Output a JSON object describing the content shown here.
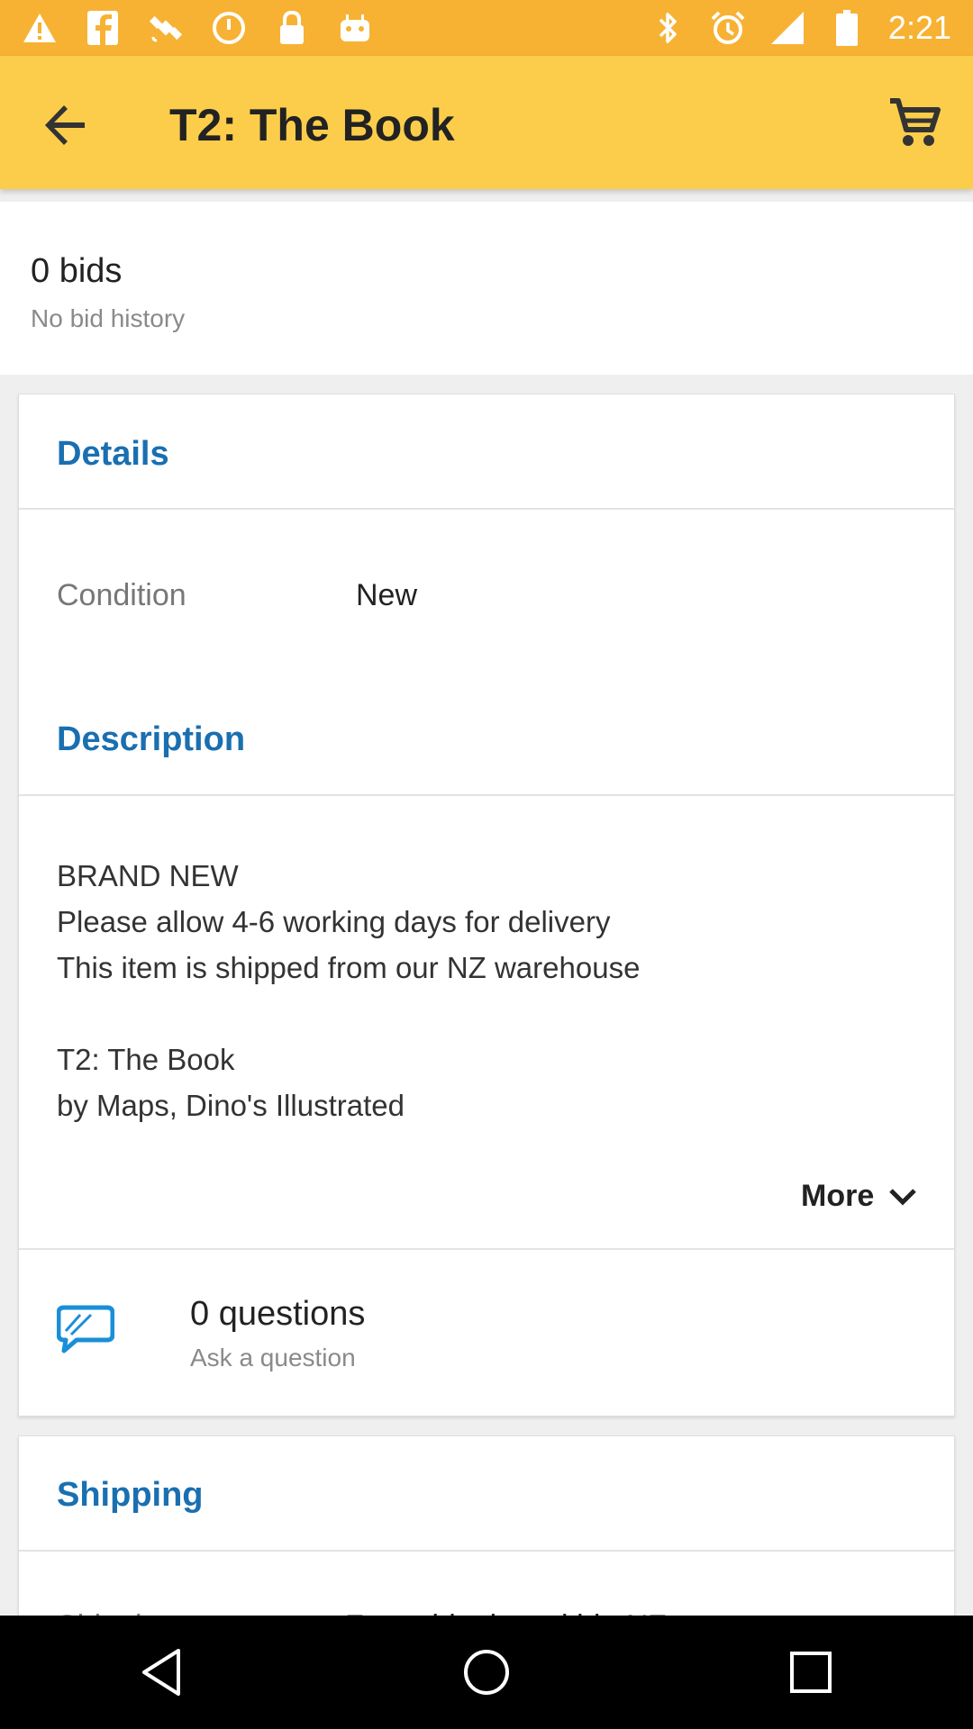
{
  "colors": {
    "status_bar": "#f7b234",
    "app_bar": "#fbcd4b",
    "accent_blue": "#1a6fb0",
    "background": "#efefef"
  },
  "status_bar": {
    "time": "2:21",
    "icons_left": [
      "warning-icon",
      "facebook-icon",
      "satellite-icon",
      "clock-icon",
      "lock-icon",
      "android-icon"
    ],
    "icons_right": [
      "bluetooth-icon"
    ]
  },
  "app_bar": {
    "title": "T2: The Book",
    "back_icon": "arrow-back-icon",
    "cart_icon": "cart-icon"
  },
  "bids": {
    "title": "0 bids",
    "subtitle": "No bid history"
  },
  "details": {
    "title": "Details",
    "rows": [
      {
        "label": "Condition",
        "value": "New"
      }
    ]
  },
  "description": {
    "title": "Description",
    "lines": [
      "BRAND NEW",
      "Please allow 4-6 working days for delivery",
      "This item is shipped from our NZ warehouse",
      "",
      "T2: The Book",
      "by Maps, Dino's Illustrated"
    ],
    "more_label": "More"
  },
  "questions": {
    "title": "0 questions",
    "subtitle": "Ask a question",
    "icon": "chat-bubble-icon"
  },
  "shipping": {
    "title": "Shipping",
    "row_label": "Shipping",
    "row_value": "Free shipping within NZ"
  },
  "nav_bar": {
    "icons": [
      "nav-back-icon",
      "nav-home-icon",
      "nav-recents-icon"
    ]
  }
}
